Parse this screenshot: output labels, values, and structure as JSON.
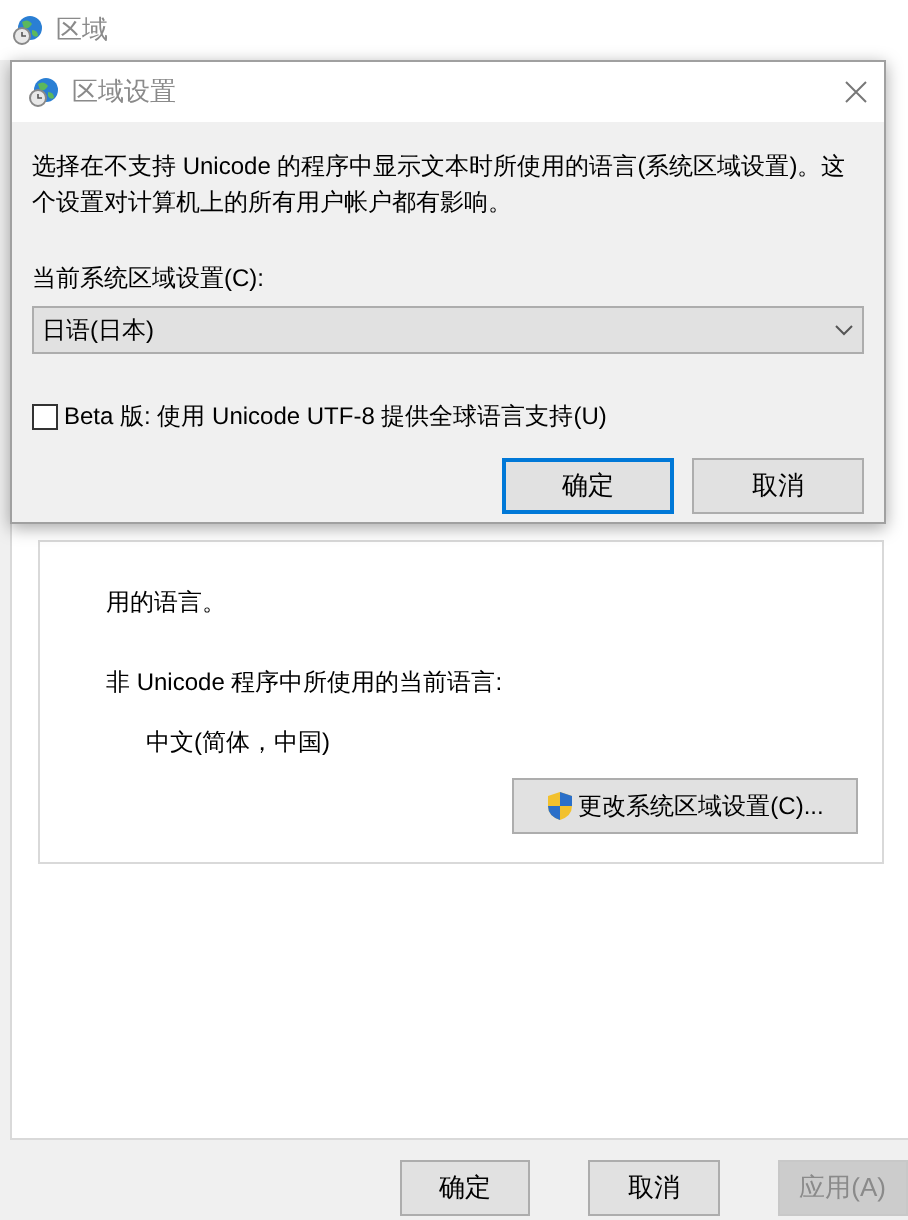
{
  "window": {
    "title": "区域"
  },
  "panel": {
    "cut_text": "用的语言。",
    "label": "非 Unicode 程序中所使用的当前语言:",
    "value": "中文(简体，中国)",
    "button": "更改系统区域设置(C)..."
  },
  "buttons": [
    {
      "label": "确定",
      "disabled": false
    },
    {
      "label": "取消",
      "disabled": false
    },
    {
      "label": "应用(A)",
      "disabled": true
    }
  ],
  "dialog": {
    "title": "区域设置",
    "description": "选择在不支持 Unicode 的程序中显示文本时所使用的语言(系统区域设置)。这个设置对计算机上的所有用户帐户都有影响。",
    "select_label": "当前系统区域设置(C):",
    "select_value": "日语(日本)",
    "beta": {
      "label": "Beta 版: 使用 Unicode UTF-8 提供全球语言支持(U)",
      "checked": false
    },
    "buttons": [
      {
        "label": "确定",
        "default": true
      },
      {
        "label": "取消",
        "default": false
      }
    ]
  }
}
